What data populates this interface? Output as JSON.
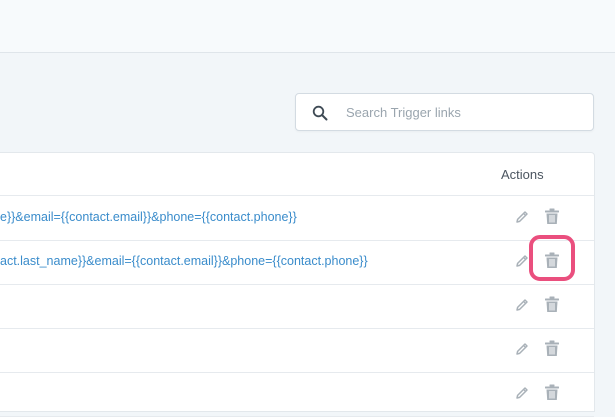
{
  "search": {
    "placeholder": "Search Trigger links",
    "value": ""
  },
  "table": {
    "actions_header": "Actions",
    "rows": [
      {
        "link": "e}}&email={{contact.email}}&phone={{contact.phone}}"
      },
      {
        "link": "act.last_name}}&email={{contact.email}}&phone={{contact.phone}}"
      },
      {
        "link": ""
      },
      {
        "link": ""
      },
      {
        "link": ""
      }
    ]
  },
  "icons": {
    "search": "search-icon",
    "edit": "pencil-icon",
    "delete": "trash-icon"
  },
  "colors": {
    "link": "#3a8ccb",
    "highlight": "#ea4f7e",
    "icon": "#a9b1b8"
  }
}
